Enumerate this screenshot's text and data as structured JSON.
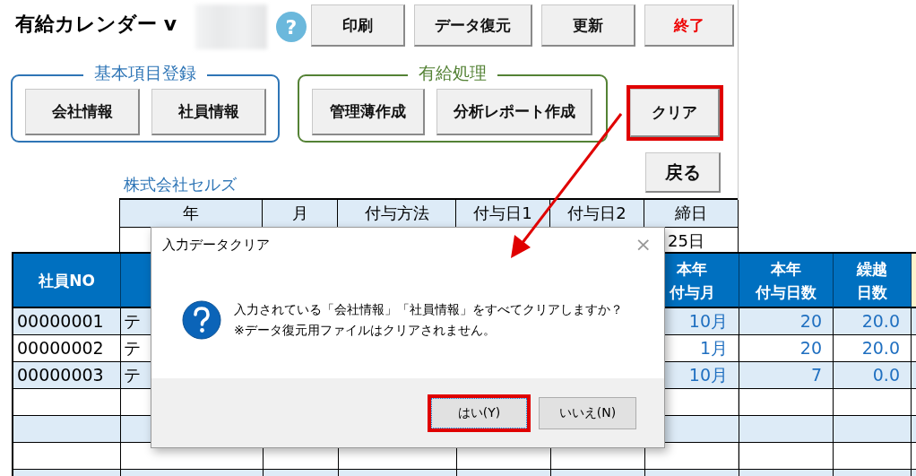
{
  "title": "有給カレンダー v",
  "help_button": "?",
  "toolbar_buttons": [
    {
      "label": "印刷",
      "kind": "normal"
    },
    {
      "label": "データ復元",
      "kind": "normal"
    },
    {
      "label": "更新",
      "kind": "normal"
    },
    {
      "label": "終了",
      "kind": "danger"
    }
  ],
  "groups": [
    {
      "title": "基本項目登録",
      "color": "#2e75b6",
      "buttons": [
        "会社情報",
        "社員情報"
      ]
    },
    {
      "title": "有給処理",
      "color": "#548235",
      "buttons": [
        "管理薄作成",
        "分析レポート作成"
      ]
    }
  ],
  "clear_button": {
    "label": "クリア",
    "highlighted": true
  },
  "back_button": "戻る",
  "company_name": "株式会社セルズ",
  "settings_table": {
    "columns": [
      "年",
      "月",
      "付与方法",
      "付与日1",
      "付与日2",
      "締日"
    ],
    "closing_day": "25日"
  },
  "employee_table": {
    "header_no": "社員NO",
    "header_grant_month": [
      "本年",
      "付与月"
    ],
    "header_grant_days": [
      "本年",
      "付与日数"
    ],
    "header_carryover": [
      "繰越",
      "日数"
    ],
    "rows": [
      {
        "no": "00000001",
        "name": "テ",
        "grant_month": "10月",
        "grant_days": "20",
        "carryover": "20.0"
      },
      {
        "no": "00000002",
        "name": "テ",
        "grant_month": "1月",
        "grant_days": "20",
        "carryover": "20.0"
      },
      {
        "no": "00000003",
        "name": "テ",
        "grant_month": "10月",
        "grant_days": "7",
        "carryover": "0.0"
      }
    ]
  },
  "dialog": {
    "title": "入力データクリア",
    "close": "×",
    "message": [
      "入力されている「会社情報」「社員情報」をすべてクリアしますか？",
      "※データ復元用ファイルはクリアされません。"
    ],
    "buttons": [
      {
        "label": "はい(Y)",
        "highlighted": true
      },
      {
        "label": "いいえ(N)",
        "highlighted": false
      }
    ]
  }
}
